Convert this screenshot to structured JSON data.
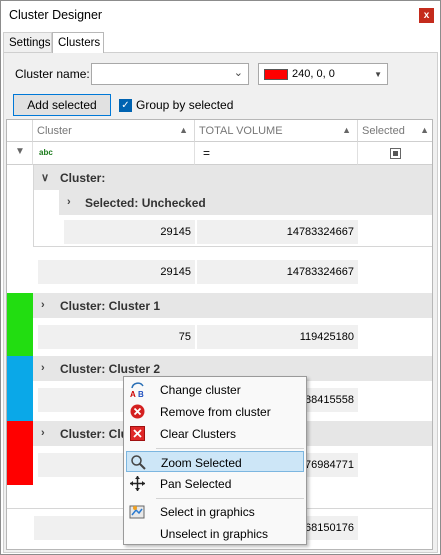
{
  "window": {
    "title": "Cluster Designer",
    "close_label": "x"
  },
  "tabs": [
    {
      "label": "Settings"
    },
    {
      "label": "Clusters"
    }
  ],
  "form": {
    "cluster_name_label": "Cluster name:",
    "cluster_name_value": "",
    "color_value": "240, 0, 0",
    "color_hex": "#ff0000",
    "add_selected_label": "Add selected",
    "group_by_selected_label": "Group by selected",
    "group_by_selected_checked": true
  },
  "grid": {
    "columns": [
      {
        "label": "Cluster"
      },
      {
        "label": "TOTAL VOLUME"
      },
      {
        "label": "Selected"
      }
    ],
    "filter": {
      "cluster_icon": "abc",
      "volume_op": "="
    },
    "groups": [
      {
        "label": "Cluster:",
        "color": "",
        "sub_label": "Selected: Unchecked",
        "sub_row": {
          "count": "29145",
          "volume": "14783324667"
        },
        "total_row": {
          "count": "29145",
          "volume": "14783324667"
        }
      },
      {
        "label": "Cluster: Cluster 1",
        "color": "#22dd11",
        "row": {
          "count": "75",
          "volume": "119425180"
        }
      },
      {
        "label": "Cluster: Cluster 2",
        "color": "#0aa8e8",
        "row": {
          "count": "",
          "volume": "88415558"
        }
      },
      {
        "label": "Cluster: Clu",
        "color": "#ff0000",
        "row": {
          "count": "",
          "volume": "76984771"
        }
      }
    ],
    "footer_row": {
      "count": "",
      "volume": "68150176"
    }
  },
  "context_menu": {
    "items": [
      {
        "label": "Change cluster",
        "icon": "change-cluster-icon"
      },
      {
        "label": "Remove from cluster",
        "icon": "remove-icon"
      },
      {
        "label": "Clear Clusters",
        "icon": "clear-clusters-icon"
      },
      {
        "label": "Zoom Selected",
        "icon": "zoom-icon",
        "highlighted": true
      },
      {
        "label": "Pan Selected",
        "icon": "pan-icon"
      },
      {
        "label": "Select in graphics",
        "icon": "select-graphics-icon"
      },
      {
        "label": "Unselect in graphics",
        "icon": ""
      }
    ]
  }
}
